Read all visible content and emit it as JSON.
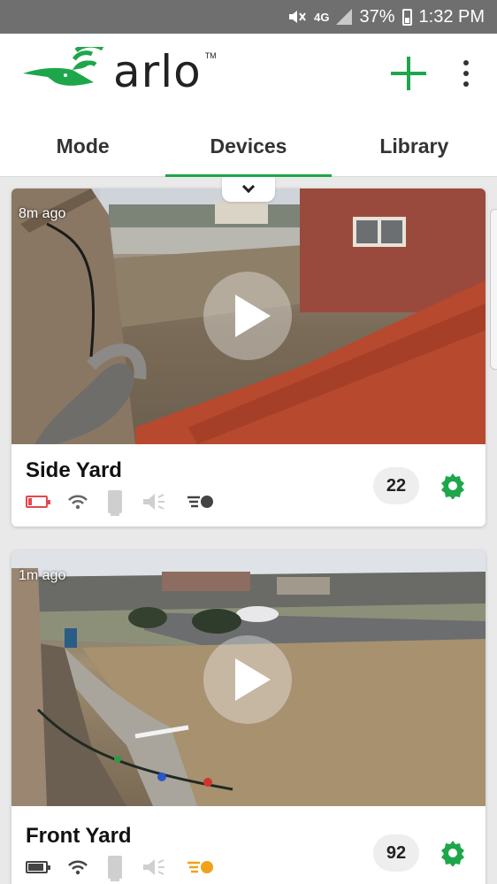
{
  "status_bar": {
    "network": "4G",
    "battery_percent": "37%",
    "time": "1:32 PM"
  },
  "header": {
    "logo_text": "arlo",
    "logo_trademark": "TM"
  },
  "tabs": [
    {
      "label": "Mode",
      "active": false
    },
    {
      "label": "Devices",
      "active": true
    },
    {
      "label": "Library",
      "active": false
    }
  ],
  "devices": [
    {
      "name": "Side Yard",
      "last_seen": "8m ago",
      "count": "22",
      "battery_level": "low"
    },
    {
      "name": "Front Yard",
      "last_seen": "1m ago",
      "count": "92",
      "battery_level": "ok"
    }
  ],
  "colors": {
    "accent_green": "#1ea64b",
    "battery_low_red": "#e5484d",
    "motion_orange": "#f0a21a",
    "motion_gray": "#444444"
  }
}
